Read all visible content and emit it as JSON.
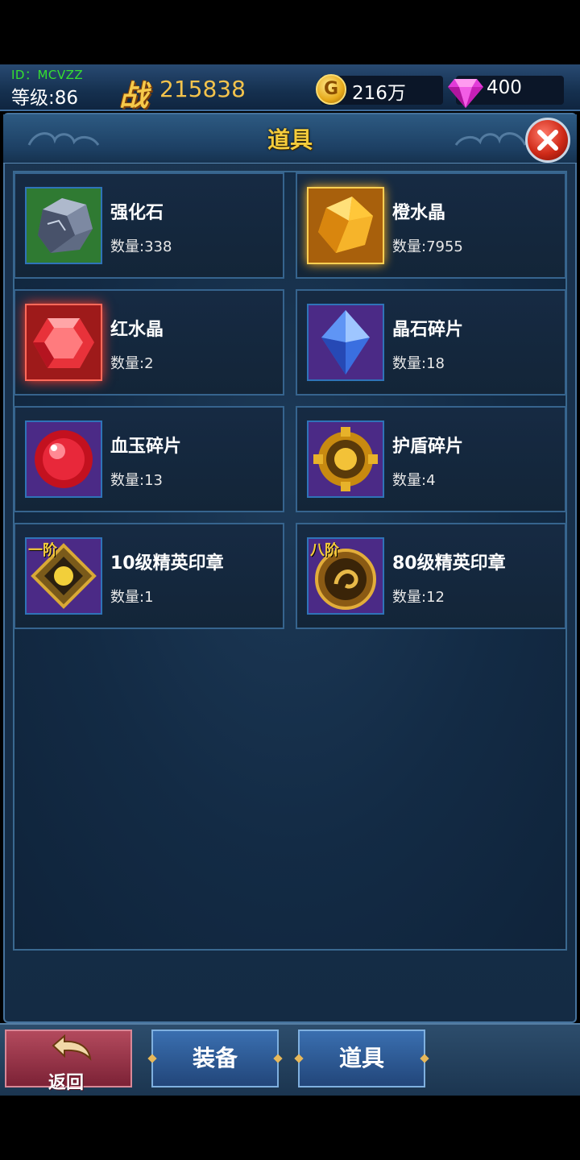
{
  "player": {
    "id_label": "ID：MCVZZ",
    "level_label": "等级:86"
  },
  "power": {
    "icon_text": "战",
    "value": "215838"
  },
  "resources": {
    "gold": {
      "icon": "gold-coin-icon",
      "icon_text": "G",
      "value": "216万"
    },
    "gems": {
      "icon": "pink-gem-icon",
      "value": "400"
    }
  },
  "panel": {
    "title": "道具"
  },
  "items": [
    {
      "name": "强化石",
      "qty": "数量:338",
      "icon": "grey-stone-icon"
    },
    {
      "name": "橙水晶",
      "qty": "数量:7955",
      "icon": "orange-crystal-icon"
    },
    {
      "name": "红水晶",
      "qty": "数量:2",
      "icon": "red-crystal-icon"
    },
    {
      "name": "晶石碎片",
      "qty": "数量:18",
      "icon": "blue-crystal-shard-icon"
    },
    {
      "name": "血玉碎片",
      "qty": "数量:13",
      "icon": "red-orb-icon"
    },
    {
      "name": "护盾碎片",
      "qty": "数量:4",
      "icon": "golden-shield-fragment-icon"
    },
    {
      "name": "10级精英印章",
      "qty": "数量:1",
      "icon": "elite-seal-tier1-icon",
      "badge": "一阶"
    },
    {
      "name": "80级精英印章",
      "qty": "数量:12",
      "icon": "elite-seal-tier8-icon",
      "badge": "八阶"
    }
  ],
  "bottom": {
    "back": "返回",
    "equip": "装备",
    "items": "道具"
  },
  "colors": {
    "accent_gold": "#f5cc3c",
    "power_gold": "#f3c34c",
    "id_green": "#35e02f",
    "frame_blue": "#2f73b8"
  }
}
